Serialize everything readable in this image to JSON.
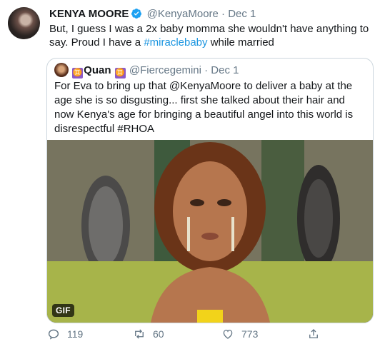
{
  "tweet": {
    "display_name": "KENYA MOORE",
    "handle": "@KenyaMoore",
    "date": "Dec 1",
    "separator": "·",
    "text_before": "But, I guess I was a 2x baby momma she wouldn't have anything to say. Proud I have a ",
    "hashtag": "#miraclebaby",
    "text_after": " while married"
  },
  "quoted": {
    "display_name": "Quan",
    "gem_symbol": "♊",
    "handle": "@Fiercegemini",
    "date": "Dec 1",
    "separator": "·",
    "text": "For Eva to bring up that @KenyaMoore to deliver a baby at the age she is so disgusting... first she talked about their hair and now Kenya's age for bringing a beautiful angel into this world is disrespectful #RHOA",
    "media_badge": "GIF"
  },
  "actions": {
    "replies": "119",
    "retweets": "60",
    "likes": "773"
  },
  "colors": {
    "link": "#1b95e0",
    "muted": "#657786",
    "verified": "#1da1f2",
    "border": "#ccd6dd"
  },
  "icons": [
    "verified-badge-icon",
    "reply-icon",
    "retweet-icon",
    "like-icon",
    "share-icon",
    "gemini-icon"
  ]
}
